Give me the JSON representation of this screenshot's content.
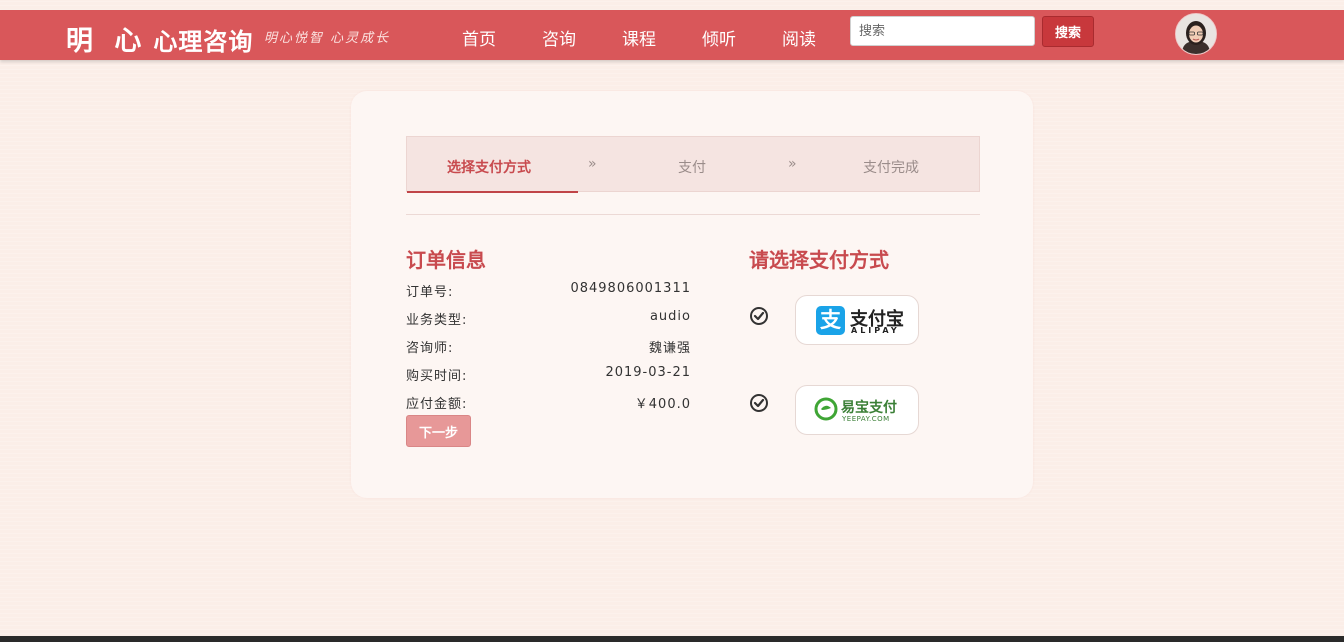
{
  "header": {
    "logo_big": "明 心",
    "logo_rest": "心理咨询",
    "slogan": "明心悦智 心灵成长",
    "nav": [
      "首页",
      "咨询",
      "课程",
      "倾听",
      "阅读"
    ],
    "search_placeholder": "搜索",
    "search_button": "搜索",
    "brand_color": "#d9575a"
  },
  "steps": {
    "items": [
      "选择支付方式",
      "支付",
      "支付完成"
    ],
    "separator": "»",
    "active_index": 0
  },
  "order": {
    "title": "订单信息",
    "rows": [
      {
        "label": "订单号:",
        "value": "0849806001311"
      },
      {
        "label": "业务类型:",
        "value": "audio"
      },
      {
        "label": "咨询师:",
        "value": "魏谦强"
      },
      {
        "label": "购买时间:",
        "value": "2019-03-21"
      },
      {
        "label": "应付金额:",
        "value": "￥400.0"
      }
    ],
    "next_button": "下一步"
  },
  "payment": {
    "title": "请选择支付方式",
    "alipay": {
      "mark": "支",
      "name": "支付宝",
      "en": "ALIPAY"
    },
    "yeepay": {
      "name": "易宝支付",
      "en": "YEEPAY.COM"
    }
  }
}
